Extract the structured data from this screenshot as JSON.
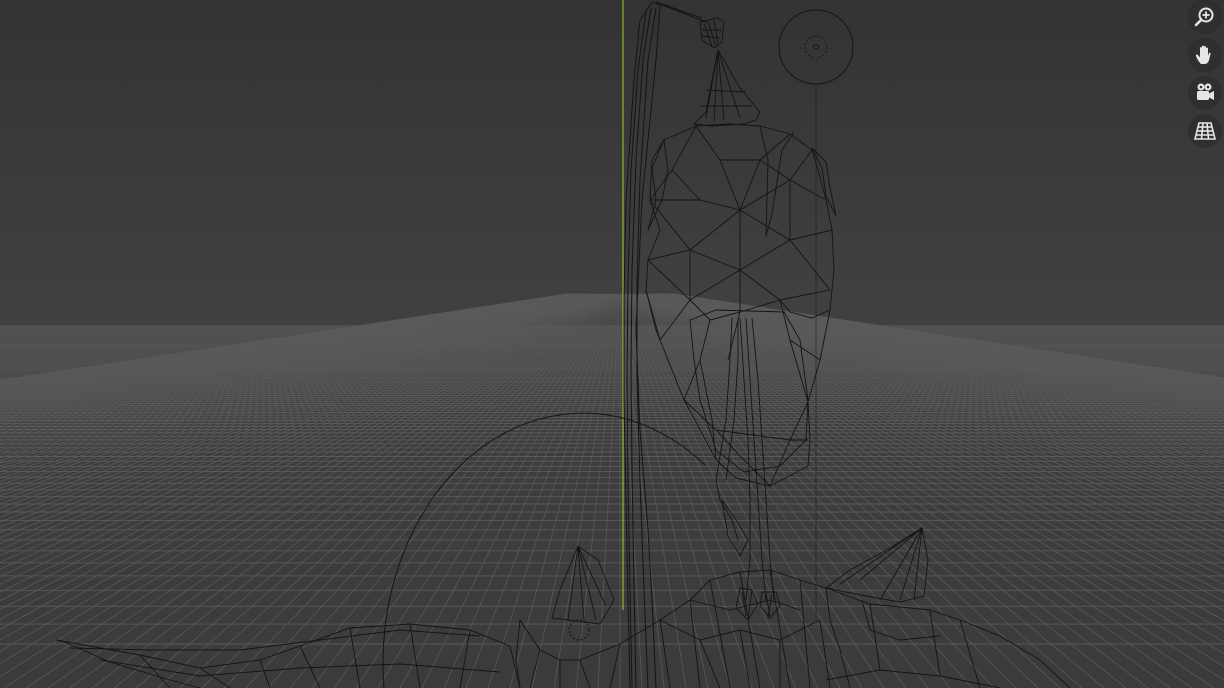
{
  "viewport": {
    "shading_mode": "wireframe",
    "colors": {
      "background_top": "#333333",
      "background_horizon": "#404040",
      "grid_line": "#5a5a5a",
      "wire": "#141414",
      "z_axis": "#9acd32"
    }
  },
  "nav_gizmo": [
    {
      "id": "zoom",
      "icon": "zoom-icon"
    },
    {
      "id": "pan",
      "icon": "hand-icon"
    },
    {
      "id": "camera",
      "icon": "camera-icon"
    },
    {
      "id": "ortho",
      "icon": "grid-perspective-icon"
    }
  ]
}
